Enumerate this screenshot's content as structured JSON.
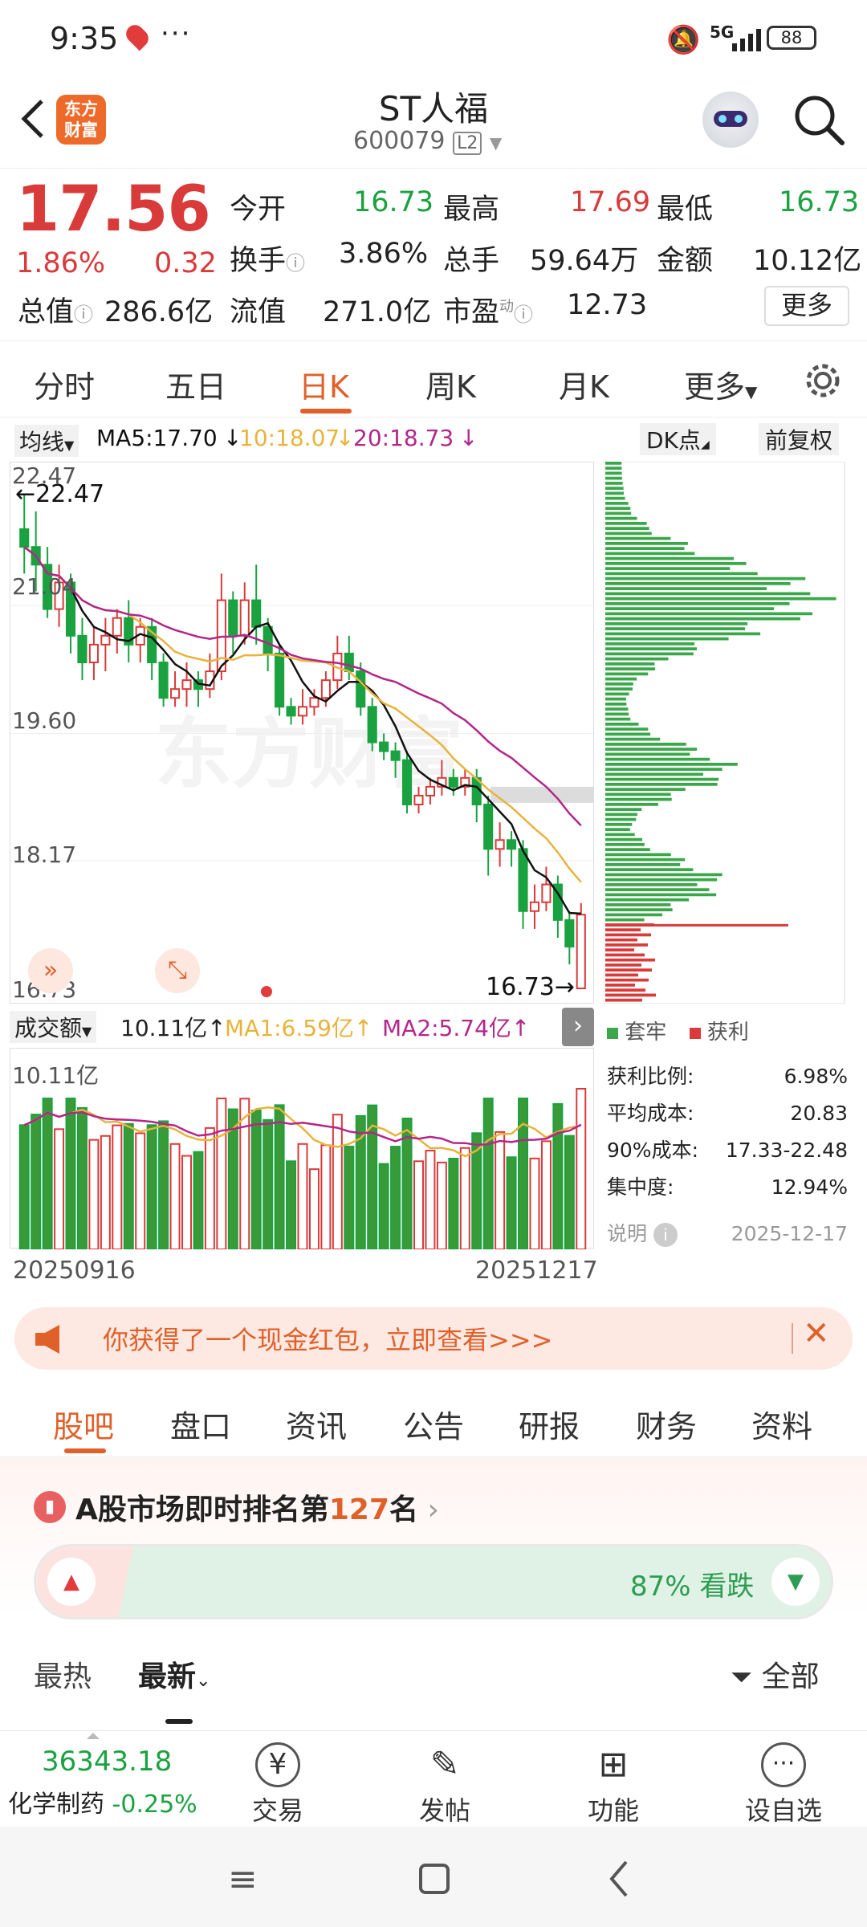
{
  "status": {
    "time": "9:35",
    "network": "5G",
    "battery": "88"
  },
  "header": {
    "title": "ST人福",
    "code": "600079",
    "level": "L2"
  },
  "quote": {
    "price": "17.56",
    "change_pct": "1.86%",
    "change": "0.32",
    "open_label": "今开",
    "open": "16.73",
    "high_label": "最高",
    "high": "17.69",
    "low_label": "最低",
    "low": "16.73",
    "turnover_label": "换手",
    "turnover": "3.86%",
    "volume_label": "总手",
    "volume": "59.64万",
    "amount_label": "金额",
    "amount": "10.12亿",
    "mktcap_label": "总值",
    "mktcap": "286.6亿",
    "float_label": "流值",
    "float": "271.0亿",
    "pe_label": "市盈",
    "pe_sup": "动",
    "pe": "12.73",
    "more_label": "更多"
  },
  "chart_tabs": [
    "分时",
    "五日",
    "日K",
    "周K",
    "月K",
    "更多"
  ],
  "ma_legend": {
    "type_label": "均线",
    "ma5": "MA5:17.70",
    "ma10": "10:18.07",
    "ma20": "20:18.73",
    "dk": "DK点",
    "adjust": "前复权"
  },
  "price_axis": {
    "top": "22.47",
    "upper": "21.04",
    "mid": "19.60",
    "lower": "18.17",
    "bottom": "16.73",
    "hi_marker": "22.47",
    "lo_marker": "16.73"
  },
  "vol_legend": {
    "type_label": "成交额",
    "amount": "10.11亿",
    "ma1": "MA1:6.59亿",
    "ma2": "MA2:5.74亿",
    "axis_top": "10.11亿"
  },
  "dates": {
    "start": "20250916",
    "end": "20251217"
  },
  "chip": {
    "legend_trap": "套牢",
    "legend_profit": "获利",
    "rows": [
      {
        "label": "获利比例:",
        "value": "6.98%"
      },
      {
        "label": "平均成本:",
        "value": "20.83"
      },
      {
        "label": "90%成本:",
        "value": "17.33-22.48"
      },
      {
        "label": "集中度:",
        "value": "12.94%"
      }
    ],
    "note_label": "说明",
    "date": "2025-12-17"
  },
  "watermark": "东方财富",
  "promo": {
    "text": "你获得了一个现金红包，立即查看>>>"
  },
  "sub_tabs": [
    "股吧",
    "盘口",
    "资讯",
    "公告",
    "研报",
    "财务",
    "资料"
  ],
  "ranking": {
    "prefix": "A股市场即时排名第",
    "rank": "127",
    "suffix": "名",
    "bear_text": "87% 看跌",
    "bear_pct": 87
  },
  "feed_tabs": {
    "hot": "最热",
    "latest": "最新",
    "filter": "全部"
  },
  "bottom": {
    "index_value": "36343.18",
    "index_name": "化学制药",
    "index_change": "-0.25%",
    "nav": [
      {
        "label": "交易"
      },
      {
        "label": "发帖"
      },
      {
        "label": "功能"
      },
      {
        "label": "设自选"
      }
    ]
  },
  "colors": {
    "accent": "#e0602a",
    "up": "#d93a3a",
    "down": "#1aa241",
    "ma5": "#111111",
    "ma10": "#e8b33c",
    "ma20": "#b3268a"
  },
  "chart_data": {
    "type": "candlestick",
    "ylim": [
      16.73,
      22.47
    ],
    "x_range": [
      "20250916",
      "20251217"
    ],
    "candles": [
      [
        21.9,
        21.7,
        22.3,
        21.4
      ],
      [
        21.7,
        21.5,
        22.1,
        21.2
      ],
      [
        21.5,
        21.0,
        21.7,
        20.9
      ],
      [
        21.0,
        21.3,
        21.5,
        20.8
      ],
      [
        21.3,
        20.7,
        21.4,
        20.5
      ],
      [
        20.7,
        20.4,
        20.9,
        20.2
      ],
      [
        20.4,
        20.6,
        20.8,
        20.2
      ],
      [
        20.6,
        20.7,
        20.9,
        20.3
      ],
      [
        20.7,
        20.9,
        21.0,
        20.5
      ],
      [
        20.9,
        20.6,
        21.1,
        20.4
      ],
      [
        20.6,
        20.8,
        20.9,
        20.4
      ],
      [
        20.8,
        20.4,
        20.9,
        20.2
      ],
      [
        20.4,
        20.0,
        20.5,
        19.9
      ],
      [
        20.0,
        20.1,
        20.3,
        19.9
      ],
      [
        20.1,
        20.2,
        20.4,
        19.9
      ],
      [
        20.2,
        20.1,
        20.3,
        19.9
      ],
      [
        20.1,
        20.3,
        20.5,
        20.0
      ],
      [
        20.3,
        21.1,
        21.4,
        20.2
      ],
      [
        21.1,
        20.7,
        21.2,
        20.5
      ],
      [
        20.7,
        21.1,
        21.3,
        20.6
      ],
      [
        21.1,
        20.8,
        21.5,
        20.6
      ],
      [
        20.8,
        20.5,
        20.9,
        20.3
      ],
      [
        20.5,
        19.9,
        20.6,
        19.8
      ],
      [
        19.9,
        19.8,
        20.0,
        19.7
      ],
      [
        19.8,
        19.9,
        20.1,
        19.7
      ],
      [
        19.9,
        20.0,
        20.1,
        19.8
      ],
      [
        20.0,
        20.2,
        20.3,
        19.9
      ],
      [
        20.2,
        20.5,
        20.7,
        20.1
      ],
      [
        20.5,
        20.3,
        20.7,
        20.2
      ],
      [
        20.3,
        19.9,
        20.4,
        19.8
      ],
      [
        19.9,
        19.5,
        20.0,
        19.4
      ],
      [
        19.5,
        19.4,
        19.6,
        19.3
      ],
      [
        19.4,
        19.3,
        19.5,
        19.1
      ],
      [
        19.3,
        18.8,
        19.4,
        18.7
      ],
      [
        18.8,
        18.9,
        19.0,
        18.7
      ],
      [
        18.9,
        19.0,
        19.1,
        18.8
      ],
      [
        19.0,
        19.1,
        19.3,
        18.9
      ],
      [
        19.1,
        19.0,
        19.2,
        18.9
      ],
      [
        19.0,
        19.1,
        19.2,
        18.9
      ],
      [
        19.1,
        18.8,
        19.2,
        18.6
      ],
      [
        18.8,
        18.3,
        18.9,
        18.0
      ],
      [
        18.3,
        18.4,
        18.6,
        18.1
      ],
      [
        18.4,
        18.3,
        18.5,
        18.1
      ],
      [
        18.3,
        17.6,
        18.4,
        17.4
      ],
      [
        17.6,
        17.7,
        17.9,
        17.4
      ],
      [
        17.7,
        17.9,
        18.1,
        17.6
      ],
      [
        17.9,
        17.5,
        18.0,
        17.3
      ],
      [
        17.5,
        17.2,
        17.6,
        17.0
      ],
      [
        16.73,
        17.56,
        17.69,
        16.73
      ]
    ]
  }
}
